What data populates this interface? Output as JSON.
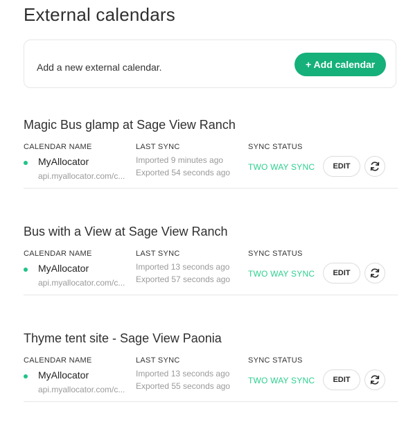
{
  "page": {
    "title": "External calendars"
  },
  "add_card": {
    "text": "Add a new external calendar.",
    "button_label": "+ Add calendar",
    "button_color": "#16b07a"
  },
  "columns": {
    "calendar_name": "CALENDAR NAME",
    "last_sync": "LAST SYNC",
    "sync_status": "SYNC STATUS"
  },
  "sections": [
    {
      "title": "Magic Bus glamp at Sage View Ranch",
      "calendar_name": "MyAllocator",
      "url": "api.myallocator.com/c...",
      "imported": "Imported 9 minutes ago",
      "exported": "Exported 54 seconds ago",
      "status": "TWO WAY SYNC",
      "edit_label": "EDIT",
      "sync_icon": "sync-icon"
    },
    {
      "title": "Bus with a View at Sage View Ranch",
      "calendar_name": "MyAllocator",
      "url": "api.myallocator.com/c...",
      "imported": "Imported 13 seconds ago",
      "exported": "Exported 57 seconds ago",
      "status": "TWO WAY SYNC",
      "edit_label": "EDIT",
      "sync_icon": "sync-icon"
    },
    {
      "title": "Thyme tent site - Sage View Paonia",
      "calendar_name": "MyAllocator",
      "url": "api.myallocator.com/c...",
      "imported": "Imported 13 seconds ago",
      "exported": "Exported 55 seconds ago",
      "status": "TWO WAY SYNC",
      "edit_label": "EDIT",
      "sync_icon": "sync-icon"
    }
  ],
  "colors": {
    "status_green": "#2cd08f",
    "active_dot": "#1fc486",
    "divider": "#e6e6e6"
  }
}
